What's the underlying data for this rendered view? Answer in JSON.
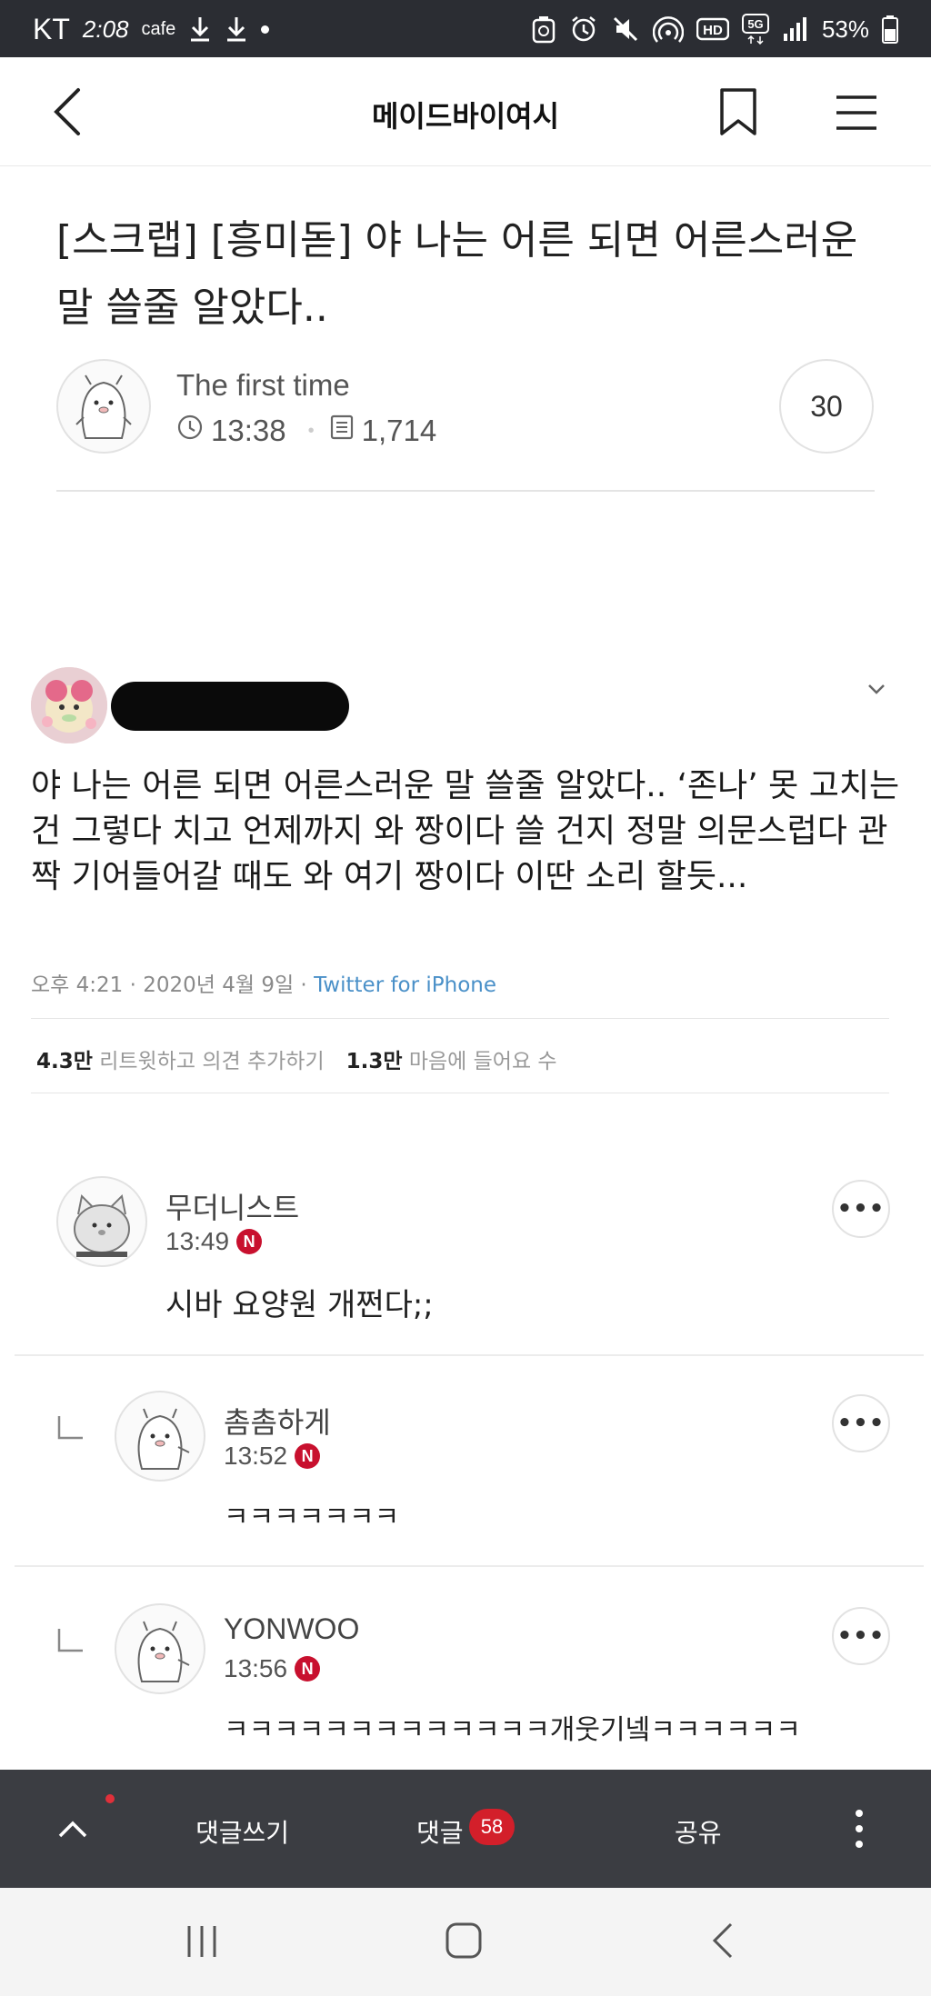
{
  "status_bar": {
    "carrier": "KT",
    "time": "2:08",
    "app_label": "cafe",
    "battery": "53%",
    "network": "5G",
    "hd_label": "HD",
    "icons": [
      "download-icon",
      "download-icon",
      "dot-icon",
      "recycle-icon",
      "alarm-icon",
      "mute-icon",
      "hotspot-icon",
      "hd-icon",
      "5g-icon",
      "signal-icon",
      "battery-icon"
    ]
  },
  "header": {
    "title": "메이드바이여시",
    "back_icon": "chevron-left-icon",
    "bookmark_icon": "bookmark-icon",
    "menu_icon": "hamburger-menu-icon"
  },
  "post": {
    "title": "[스크랩] [흥미돋] 야 나는 어른 되면 어른스러운 말 쓸줄 알았다..",
    "author": "The first time",
    "time": "13:38",
    "views": "1,714",
    "comment_count": "30"
  },
  "tweet": {
    "text": "야 나는 어른 되면 어른스러운 말 쓸줄 알았다.. ‘존나’ 못 고치는 건 그렇다 치고 언제까지 와 짱이다 쓸 건지 정말 의문스럽다 관짝 기어들어갈 때도 와 여기 짱이다 이딴 소리 할듯...",
    "meta": "오후 4:21 · 2020년 4월 9일 · ",
    "app": "Twitter for iPhone",
    "retweets_value": "4.3만",
    "retweets_label": "리트윗하고 의견 추가하기",
    "likes_value": "1.3만",
    "likes_label": "마음에 들어요 수"
  },
  "comments": [
    {
      "author": "무더니스트",
      "time": "13:49",
      "badge": "N",
      "text": "시바 요양원 개쩐다;;",
      "more": "•••"
    },
    {
      "author": "촘촘하게",
      "time": "13:52",
      "badge": "N",
      "text": "ㅋㅋㅋㅋㅋㅋㅋ",
      "more": "•••"
    },
    {
      "author": "YONWOO",
      "time": "13:56",
      "badge": "N",
      "text": "ㅋㅋㅋㅋㅋㅋㅋㅋㅋㅋㅋㅋㅋ개웃기넼ㅋㅋㅋㅋㅋㅋ",
      "more": "•••"
    }
  ],
  "bottom_bar": {
    "write_label": "댓글쓰기",
    "comments_label": "댓글",
    "comments_count": "58",
    "share_label": "공유"
  },
  "colors": {
    "status_bar_bg": "#2b2d33",
    "bottom_bar_bg": "#3b3d42",
    "badge_red": "#d31f2a",
    "n_badge_red": "#c8102e",
    "twitter_link": "#4a90c8"
  }
}
